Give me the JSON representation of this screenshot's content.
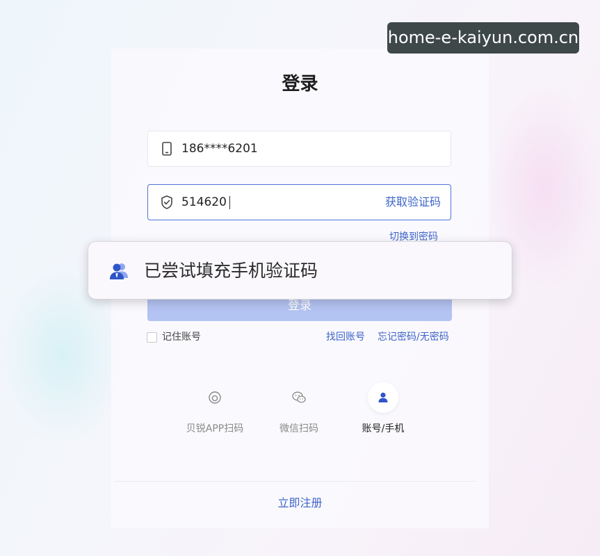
{
  "watermark": "home-e-kaiyun.com.cn",
  "title": "登录",
  "phone_field": {
    "icon": "phone-icon",
    "value": "186****6201"
  },
  "code_field": {
    "icon": "shield-check-icon",
    "value": "514620",
    "action": "获取验证码"
  },
  "switch_link": "切换到密码",
  "login_button": "登录",
  "toast": {
    "icon": "account-users-icon",
    "text": "已尝试填充手机验证码"
  },
  "remember_label": "记住账号",
  "links": {
    "recover_account": "找回账号",
    "forgot_password": "忘记密码/无密码"
  },
  "login_options": [
    {
      "label": "贝锐APP扫码",
      "icon": "app-scan-icon",
      "active": false
    },
    {
      "label": "微信扫码",
      "icon": "wechat-icon",
      "active": false
    },
    {
      "label": "账号/手机",
      "icon": "user-icon",
      "active": true
    }
  ],
  "register_link": "立即注册",
  "colors": {
    "accent": "#3d64c9",
    "button_disabled": "#b3c3f2",
    "watermark_bg": "#3e4849"
  }
}
